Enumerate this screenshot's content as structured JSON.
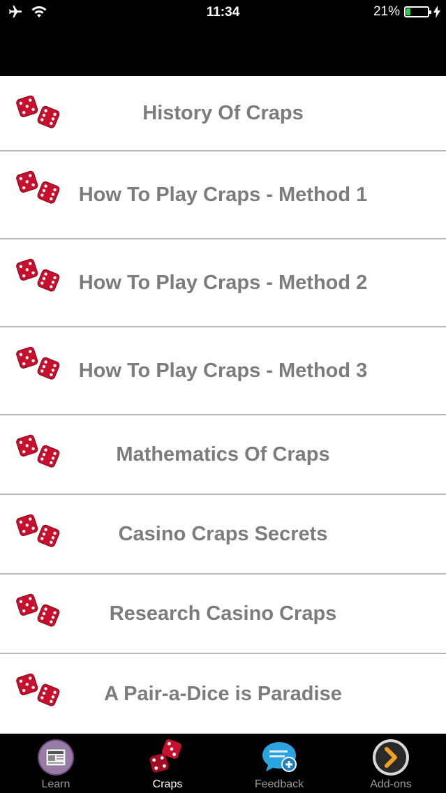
{
  "status_bar": {
    "time": "11:34",
    "battery_percent": "21%",
    "battery_level": 0.21
  },
  "menu": {
    "items": [
      {
        "label": "History Of Craps"
      },
      {
        "label": "How To Play Craps - Method 1"
      },
      {
        "label": "How To Play Craps - Method 2"
      },
      {
        "label": "How To Play Craps - Method 3"
      },
      {
        "label": "Mathematics Of Craps"
      },
      {
        "label": "Casino Craps Secrets"
      },
      {
        "label": "Research Casino Craps"
      },
      {
        "label": "A Pair-a-Dice is Paradise"
      }
    ]
  },
  "tab_bar": {
    "tabs": [
      {
        "label": "Learn",
        "icon": "newspaper-icon",
        "active": false
      },
      {
        "label": "Craps",
        "icon": "dice-icon",
        "active": true
      },
      {
        "label": "Feedback",
        "icon": "speech-bubble-plus-icon",
        "active": false
      },
      {
        "label": "Add-ons",
        "icon": "chevron-circle-icon",
        "active": false
      }
    ]
  },
  "colors": {
    "row_text": "#7c7c7c",
    "dice_red": "#c8102e",
    "battery_green": "#28d14c"
  }
}
